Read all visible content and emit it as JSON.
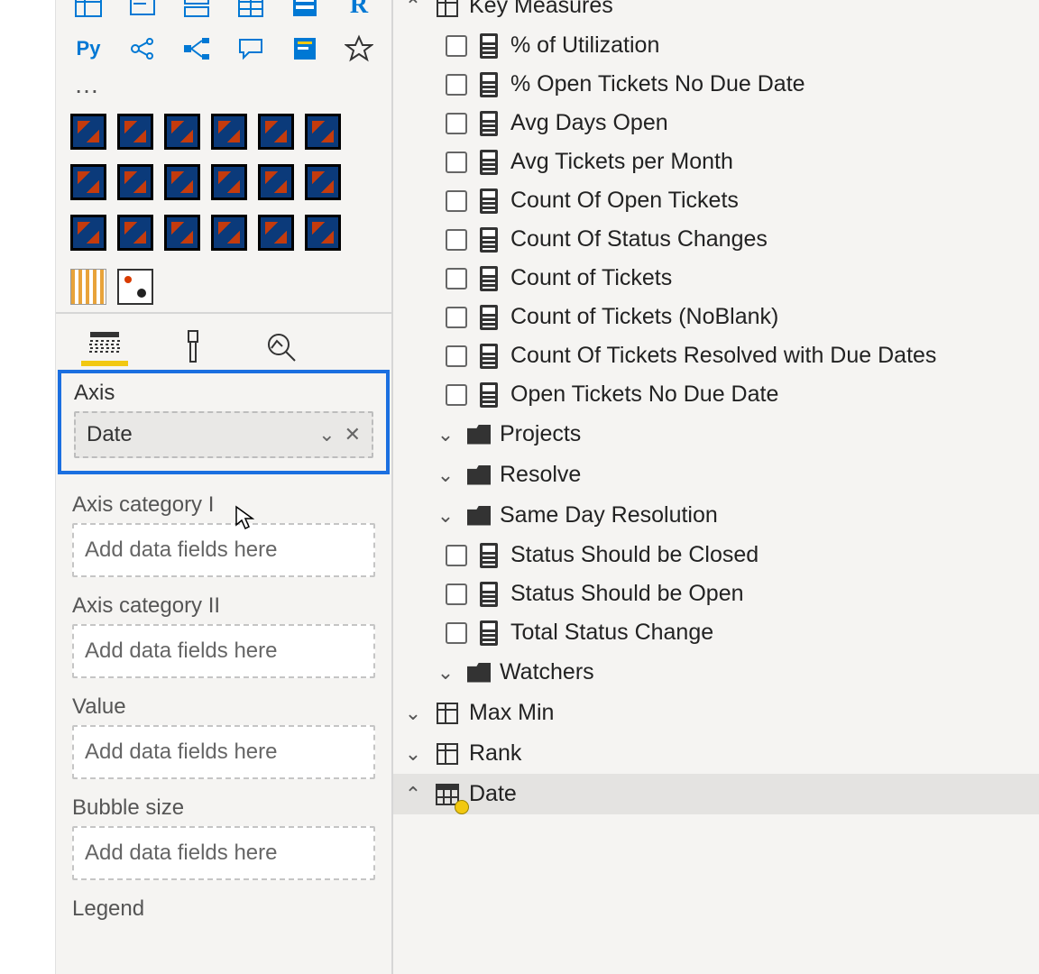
{
  "viz": {
    "py": "Py",
    "ellipsis": "…"
  },
  "wells": {
    "axis": {
      "label": "Axis",
      "value": "Date"
    },
    "cat1": {
      "label": "Axis category I",
      "placeholder": "Add data fields here"
    },
    "cat2": {
      "label": "Axis category II",
      "placeholder": "Add data fields here"
    },
    "value": {
      "label": "Value",
      "placeholder": "Add data fields here"
    },
    "bubble": {
      "label": "Bubble size",
      "placeholder": "Add data fields here"
    },
    "legend": {
      "label": "Legend"
    }
  },
  "tables": {
    "keyMeasures": {
      "name": "Key Measures",
      "fields": [
        "% of Utilization",
        "% Open Tickets No Due Date",
        "Avg Days Open",
        "Avg Tickets per Month",
        "Count Of Open Tickets",
        "Count Of Status Changes",
        "Count of Tickets",
        "Count of Tickets (NoBlank)",
        "Count Of Tickets Resolved with Due Dates",
        "Open Tickets No Due Date"
      ],
      "folders": [
        "Projects",
        "Resolve",
        "Same Day Resolution"
      ],
      "afterFolders": [
        "Status Should be Closed",
        "Status Should be Open",
        "Total Status Change"
      ],
      "watchers": "Watchers"
    },
    "maxmin": "Max Min",
    "rank": "Rank",
    "date": "Date"
  }
}
